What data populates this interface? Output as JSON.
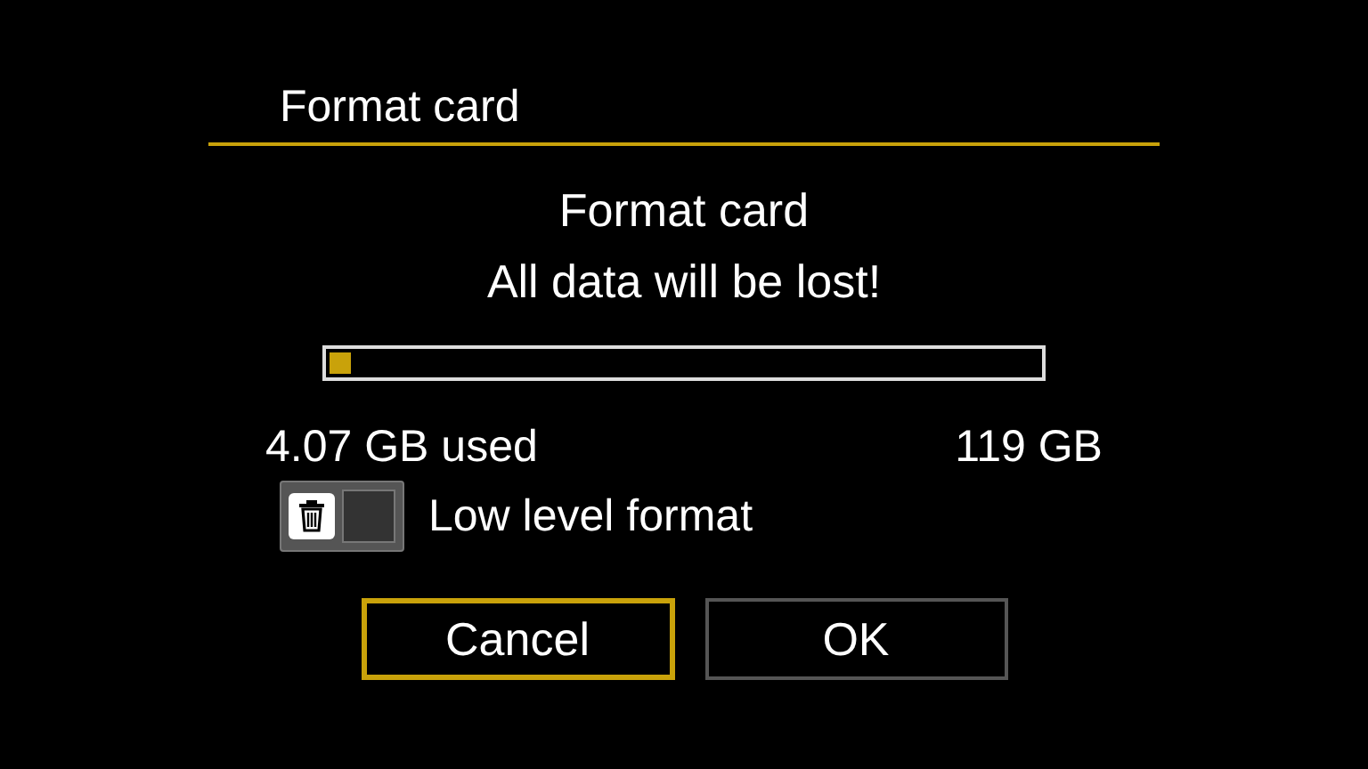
{
  "title": "Format card",
  "message": [
    "Format card",
    "All data will be lost!"
  ],
  "progress": {
    "level": 0.03
  },
  "used": "4.07 GB used",
  "capacity": "119 GB",
  "low_level_format": {
    "label": "Low level format",
    "checked": false
  },
  "buttons": [
    {
      "label": "Cancel",
      "selected": true
    },
    {
      "label": "OK",
      "selected": false
    }
  ]
}
